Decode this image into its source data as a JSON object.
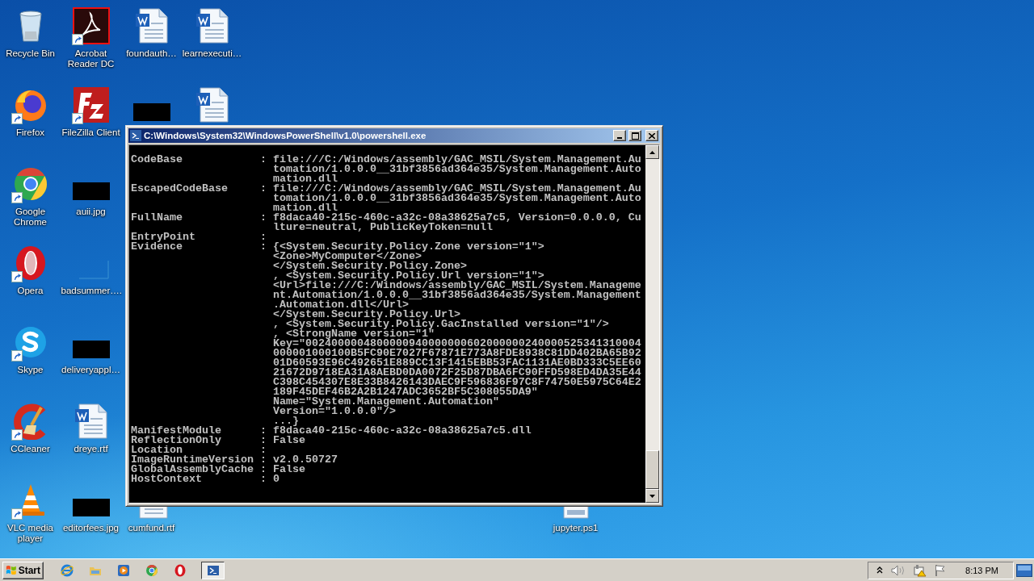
{
  "desktop": {
    "icons": [
      {
        "kind": "recycle-bin",
        "label": "Recycle Bin",
        "shortcut": false
      },
      {
        "kind": "firefox",
        "label": "Firefox",
        "shortcut": true
      },
      {
        "kind": "chrome",
        "label": "Google Chrome",
        "shortcut": true
      },
      {
        "kind": "opera",
        "label": "Opera",
        "shortcut": true
      },
      {
        "kind": "skype",
        "label": "Skype",
        "shortcut": true
      },
      {
        "kind": "ccleaner",
        "label": "CCleaner",
        "shortcut": true
      },
      {
        "kind": "vlc",
        "label": "VLC media player",
        "shortcut": true
      },
      {
        "kind": "acrobat",
        "label": "Acrobat Reader DC",
        "shortcut": true
      },
      {
        "kind": "filezilla",
        "label": "FileZilla Client",
        "shortcut": true
      },
      {
        "kind": "redacted",
        "label": "auii.jpg",
        "shortcut": false
      },
      {
        "kind": "blank",
        "label": "badsummer….",
        "shortcut": false
      },
      {
        "kind": "redacted",
        "label": "deliveryappl…",
        "shortcut": false
      },
      {
        "kind": "document",
        "label": "dreye.rtf",
        "shortcut": false
      },
      {
        "kind": "redacted",
        "label": "editorfees.jpg",
        "shortcut": false
      },
      {
        "kind": "document",
        "label": "foundauth…",
        "shortcut": false
      },
      {
        "kind": "redacted",
        "shortcut": false
      },
      {
        "kind": "document",
        "label": "cumfund.rtf",
        "shortcut": false
      },
      {
        "kind": "document",
        "label": "learnexecuti…",
        "shortcut": false
      },
      {
        "kind": "document",
        "shortcut": false
      },
      {
        "kind": "script",
        "label": "jupyter.ps1",
        "shortcut": false
      }
    ]
  },
  "console_window": {
    "title": "C:\\Windows\\System32\\WindowsPowerShell\\v1.0\\powershell.exe",
    "separator": ":",
    "properties": [
      {
        "name": "CodeBase",
        "value_lines": [
          "file:///C:/Windows/assembly/GAC_MSIL/System.Management.Au",
          "tomation/1.0.0.0__31bf3856ad364e35/System.Management.Auto",
          "mation.dll"
        ]
      },
      {
        "name": "EscapedCodeBase",
        "value_lines": [
          "file:///C:/Windows/assembly/GAC_MSIL/System.Management.Au",
          "tomation/1.0.0.0__31bf3856ad364e35/System.Management.Auto",
          "mation.dll"
        ]
      },
      {
        "name": "FullName",
        "value_lines": [
          "f8daca40-215c-460c-a32c-08a38625a7c5, Version=0.0.0.0, Cu",
          "lture=neutral, PublicKeyToken=null"
        ]
      },
      {
        "name": "EntryPoint"
      },
      {
        "name": "Evidence",
        "value_lines": [
          "{<System.Security.Policy.Zone version=\"1\">",
          "<Zone>MyComputer</Zone>",
          "</System.Security.Policy.Zone>",
          ", <System.Security.Policy.Url version=\"1\">",
          "<Url>file:///C:/Windows/assembly/GAC_MSIL/System.Manageme",
          "nt.Automation/1.0.0.0__31bf3856ad364e35/System.Management",
          ".Automation.dll</Url>",
          "</System.Security.Policy.Url>",
          ", <System.Security.Policy.GacInstalled version=\"1\"/>",
          ", <StrongName version=\"1\"",
          "Key=\"0024000004800000940000000602000000240000525341310004",
          "000001000100B5FC90E7027F67871E773A8FDE8938C81DD402BA65B92",
          "01D60593E96C492651E889CC13F1415EBB53FAC1131AE0BD333C5EE60",
          "21672D9718EA31A8AEBD0DA0072F25D87DBA6FC90FFD598ED4DA35E44",
          "C398C454307E8E33B8426143DAEC9F596836F97C8F74750E5975C64E2",
          "189F45DEF46B2A2B1247ADC3652BF5C308055DA9\"",
          "Name=\"System.Management.Automation\"",
          "Version=\"1.0.0.0\"/>",
          "...}"
        ]
      },
      {
        "name": "ManifestModule",
        "value_lines": [
          "f8daca40-215c-460c-a32c-08a38625a7c5.dll"
        ]
      },
      {
        "name": "ReflectionOnly",
        "value_lines": [
          "False"
        ]
      },
      {
        "name": "Location"
      },
      {
        "name": "ImageRuntimeVersion",
        "value_lines": [
          "v2.0.50727"
        ]
      },
      {
        "name": "GlobalAssemblyCache",
        "value_lines": [
          "False"
        ]
      },
      {
        "name": "HostContext",
        "value_lines": [
          "0"
        ]
      }
    ]
  },
  "taskbar": {
    "start_label": "Start",
    "quick_launch": [
      {
        "kind": "ie"
      },
      {
        "kind": "folder"
      },
      {
        "kind": "media"
      },
      {
        "kind": "chrome"
      },
      {
        "kind": "opera"
      }
    ],
    "tasks": [
      {
        "kind": "powershell",
        "selected": true
      }
    ],
    "tray": {
      "clock": "8:13 PM"
    }
  }
}
